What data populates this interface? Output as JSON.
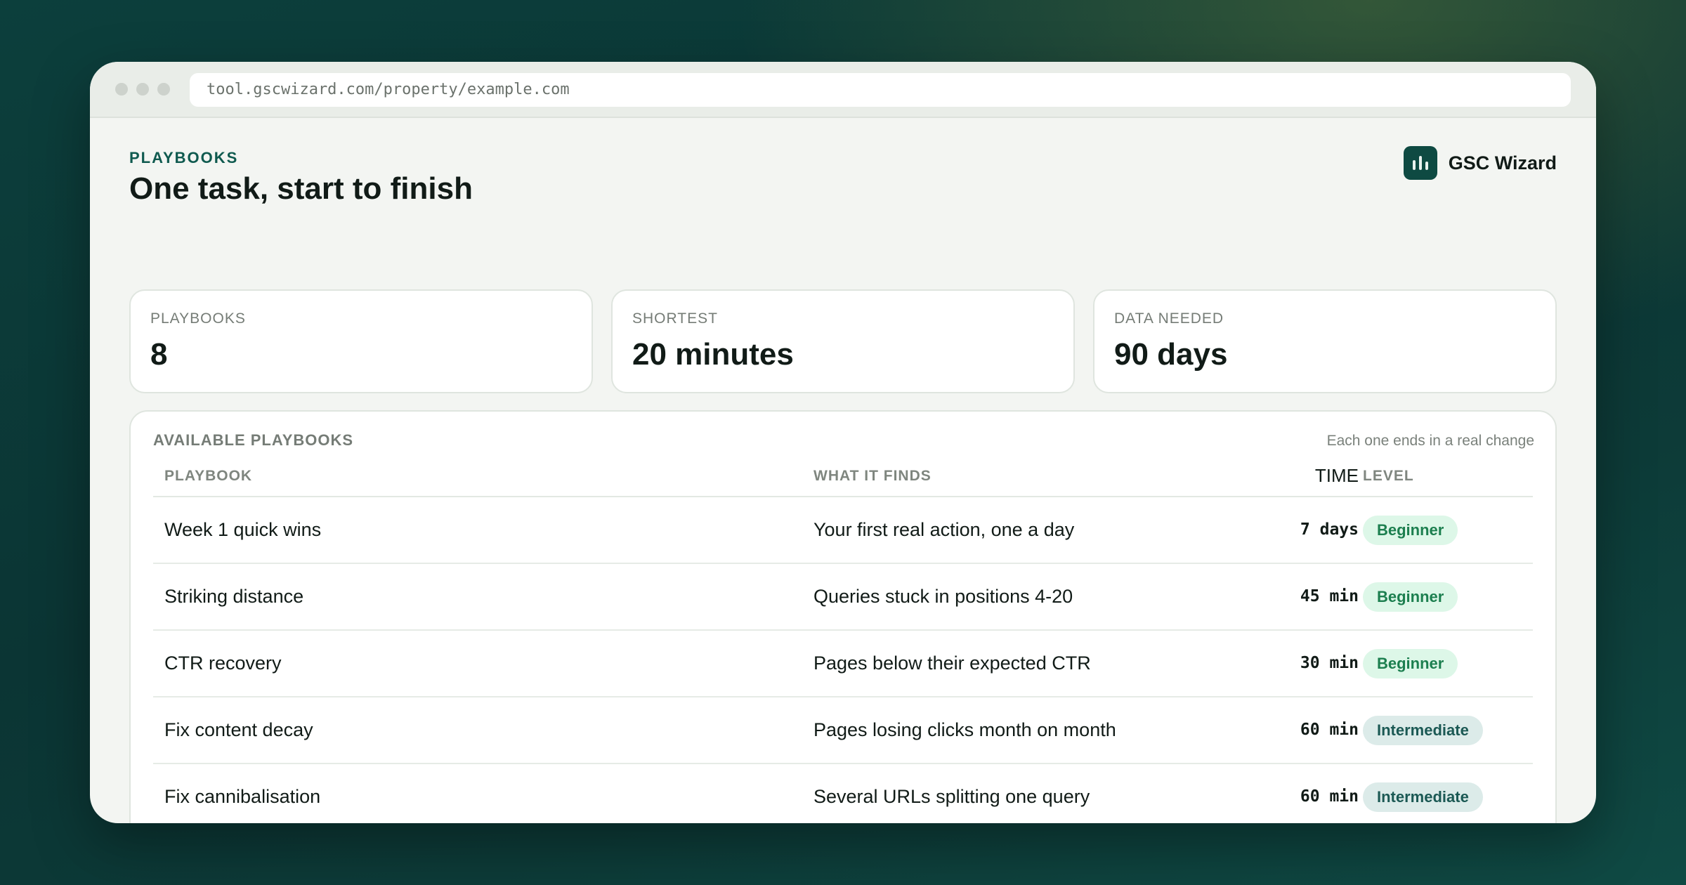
{
  "browser": {
    "url": "tool.gscwizard.com/property/example.com"
  },
  "header": {
    "eyebrow": "PLAYBOOKS",
    "title": "One task, start to finish",
    "brand_name": "GSC Wizard",
    "brand_icon": "bar-chart-icon"
  },
  "stats": [
    {
      "label": "PLAYBOOKS",
      "value": "8"
    },
    {
      "label": "SHORTEST",
      "value": "20 minutes"
    },
    {
      "label": "DATA NEEDED",
      "value": "90 days"
    }
  ],
  "table": {
    "title": "AVAILABLE PLAYBOOKS",
    "note": "Each one ends in a real change",
    "columns": {
      "playbook": "PLAYBOOK",
      "finds": "WHAT IT FINDS",
      "time": "TIME",
      "level": "LEVEL"
    },
    "rows": [
      {
        "playbook": "Week 1 quick wins",
        "finds": "Your first real action, one a day",
        "time": "7 days",
        "level": "Beginner"
      },
      {
        "playbook": "Striking distance",
        "finds": "Queries stuck in positions 4-20",
        "time": "45 min",
        "level": "Beginner"
      },
      {
        "playbook": "CTR recovery",
        "finds": "Pages below their expected CTR",
        "time": "30 min",
        "level": "Beginner"
      },
      {
        "playbook": "Fix content decay",
        "finds": "Pages losing clicks month on month",
        "time": "60 min",
        "level": "Intermediate"
      },
      {
        "playbook": "Fix cannibalisation",
        "finds": "Several URLs splitting one query",
        "time": "60 min",
        "level": "Intermediate"
      }
    ]
  },
  "colors": {
    "accent": "#0f5a4f",
    "beginner_bg": "#ddf7e8",
    "beginner_text": "#1c7f4f",
    "intermediate_bg": "#dcebe9",
    "intermediate_text": "#1b5954"
  }
}
